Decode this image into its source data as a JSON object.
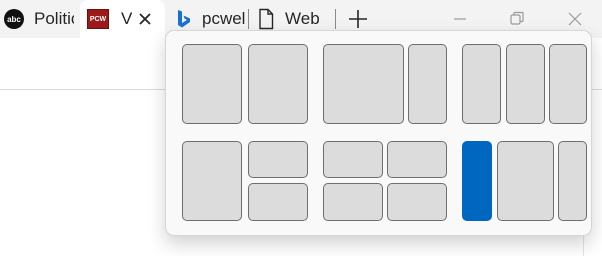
{
  "tabs": [
    {
      "label": "Politic",
      "favicon": "abc-news-logo-icon",
      "favicon_text": "abc"
    },
    {
      "label": "V",
      "favicon": "pcworld-logo-icon",
      "favicon_text": "PCW",
      "active": true
    },
    {
      "label": "pcwel",
      "favicon": "bing-logo-icon"
    },
    {
      "label": "Web",
      "favicon": "page-icon"
    }
  ],
  "icons": {
    "close_tab": "close-icon",
    "new_tab": "plus-icon",
    "minimize": "minimize-icon",
    "restore": "restore-icon",
    "close_window": "close-icon"
  },
  "snap_layouts": {
    "layout_count": 6,
    "selected_color": "#0067c0",
    "cell_fill": "#dcdcdc",
    "cell_border": "#6e6e6e"
  }
}
